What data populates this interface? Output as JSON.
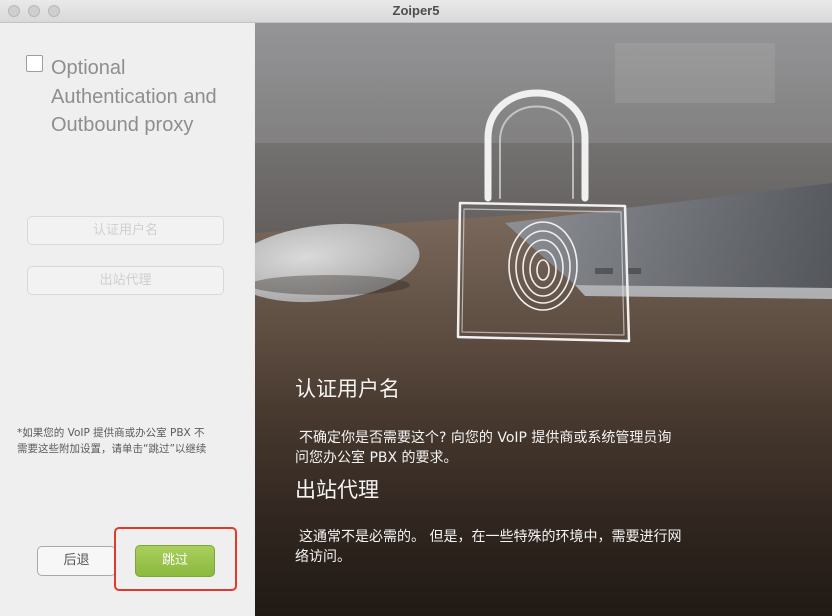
{
  "window": {
    "title": "Zoiper5"
  },
  "left": {
    "checkbox": {
      "label_lines": [
        "Optional",
        "Authentication and",
        "Outbound proxy"
      ],
      "checked": false
    },
    "auth_username": {
      "placeholder": "认证用户名"
    },
    "outbound_proxy": {
      "placeholder": "出站代理"
    },
    "note_lines": [
      "*如果您的 VoIP 提供商或办公室 PBX 不",
      "需要这些附加设置，请单击“跳过”以继续"
    ],
    "back_label": "后退",
    "skip_label": "跳过",
    "accent_color": "#99c24d",
    "highlight_color": "#e03a2f"
  },
  "info": {
    "auth_heading": "认证用户名",
    "auth_text_lines": [
      "不确定你是否需要这个?  向您的 VoIP 提供商或系统管理员询",
      "问您办公室 PBX 的要求。"
    ],
    "proxy_heading": "出站代理",
    "proxy_text_lines": [
      "这通常不是必需的。 但是，在一些特殊的环境中，需要进行网",
      "络访问。"
    ],
    "illustration_icon": "padlock-fingerprint-icon"
  }
}
